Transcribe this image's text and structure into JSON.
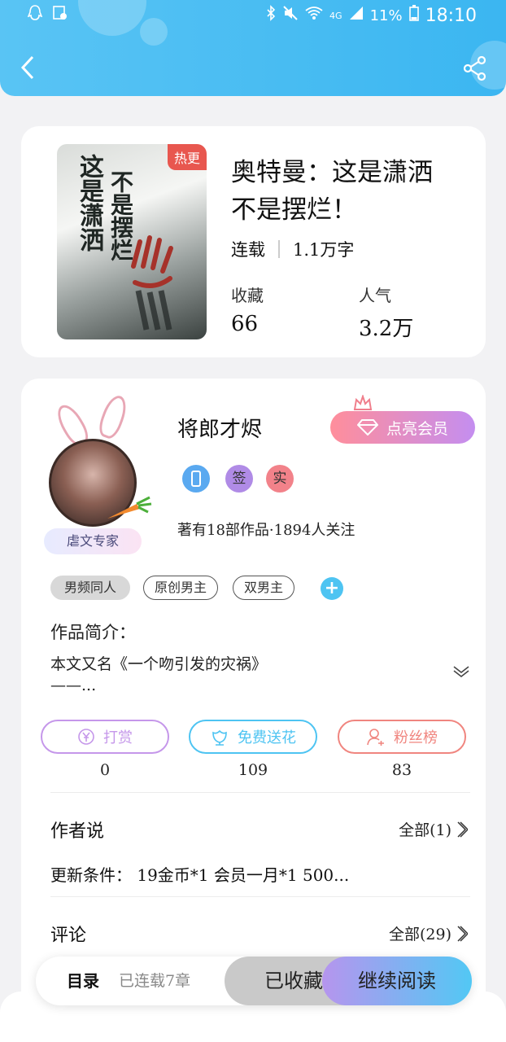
{
  "status_bar": {
    "battery": "11%",
    "time": "18:10",
    "network": "4G"
  },
  "book": {
    "badge": "热更",
    "cover_text_1": "这是潇洒",
    "cover_text_2": "不是摆烂",
    "title": "奥特曼：这是潇洒不是摆烂！",
    "status": "连载",
    "word_count": "1.1万字",
    "favorites_label": "收藏",
    "favorites_value": "66",
    "popularity_label": "人气",
    "popularity_value": "3.2万"
  },
  "author": {
    "name": "将郎才烬",
    "vip_button": "点亮会员",
    "title_badge": "虐文专家",
    "badges": [
      "签",
      "实"
    ],
    "works_info": "著有18部作品·1894人关注"
  },
  "tags": [
    "男频同人",
    "原创男主",
    "双男主"
  ],
  "intro": {
    "heading": "作品简介：",
    "text": "本文又名《一个吻引发的灾祸》",
    "text_more": "——..."
  },
  "actions": [
    {
      "label": "打赏",
      "count": "0",
      "color": "#c597ea"
    },
    {
      "label": "免费送花",
      "count": "109",
      "color": "#4ec4f2"
    },
    {
      "label": "粉丝榜",
      "count": "83",
      "color": "#f0857f"
    }
  ],
  "author_says": {
    "heading": "作者说",
    "more": "全部(1)",
    "text": "更新条件： 19金币*1 会员一月*1 500..."
  },
  "comments": {
    "heading": "评论",
    "more": "全部(29)"
  },
  "bottom": {
    "toc": "目录",
    "chapters": "已连载7章",
    "collected": "已收藏",
    "continue": "继续阅读"
  },
  "colors": {
    "header": "#4fc0f3",
    "vip_gradient_start": "#ff8e9b",
    "vip_gradient_end": "#c48ef0"
  }
}
